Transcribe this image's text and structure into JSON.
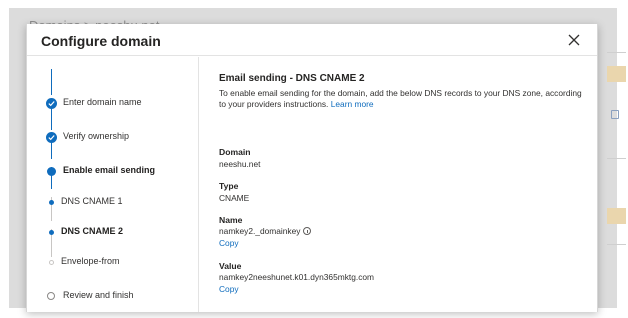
{
  "background_page": {
    "title": "Domains > neeshu.net"
  },
  "dialog": {
    "title": "Configure domain",
    "close_icon": "close-icon"
  },
  "steps": [
    {
      "label": "Enter domain name",
      "state": "completed"
    },
    {
      "label": "Verify ownership",
      "state": "completed"
    },
    {
      "label": "Enable email sending",
      "state": "current"
    },
    {
      "label": "DNS CNAME 1",
      "state": "substep-done"
    },
    {
      "label": "DNS CNAME 2",
      "state": "substep-current"
    },
    {
      "label": "Envelope-from",
      "state": "substep-pending"
    },
    {
      "label": "Review and finish",
      "state": "pending"
    }
  ],
  "content": {
    "section_title": "Email sending - DNS CNAME 2",
    "intro_text": "To enable email sending for the domain, add the below DNS records to your DNS zone, according to your providers instructions.",
    "learn_more": "Learn more",
    "fields": {
      "domain_label": "Domain",
      "domain_value": "neeshu.net",
      "type_label": "Type",
      "type_value": "CNAME",
      "name_label": "Name",
      "name_value": "namkey2._domainkey",
      "name_copy": "Copy",
      "value_label": "Value",
      "value_value": "namkey2neeshunet.k01.dyn365mktg.com",
      "value_copy": "Copy"
    }
  },
  "colors": {
    "accent": "#0f6cbd",
    "text": "#323130",
    "overlay": "#dcdcdc"
  }
}
